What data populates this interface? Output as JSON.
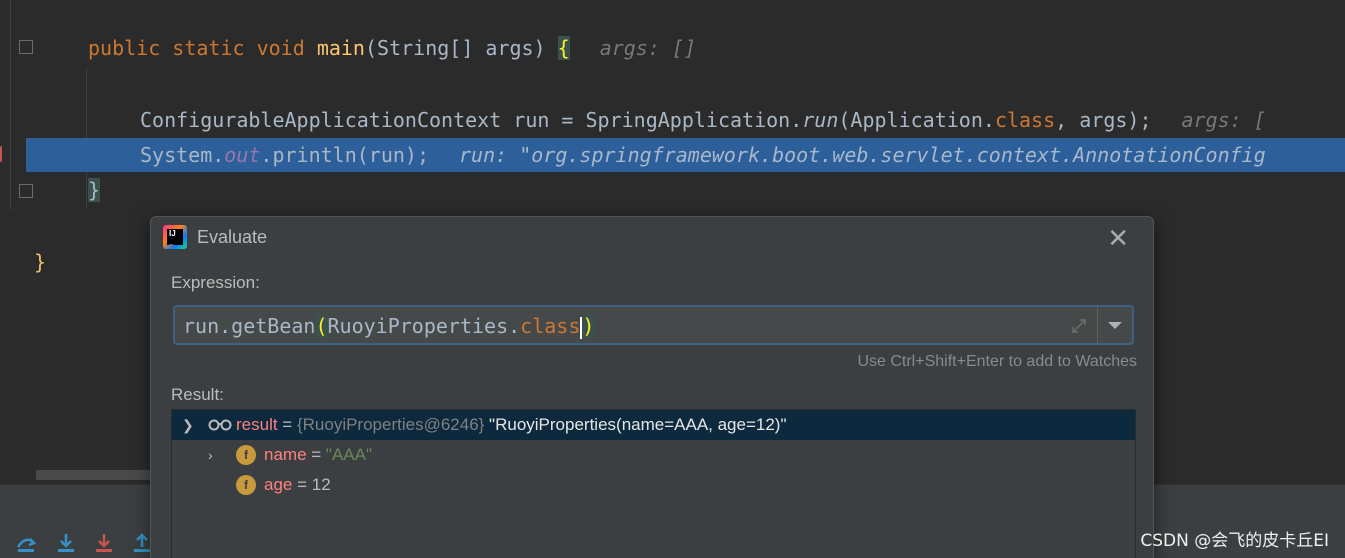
{
  "editor": {
    "line1": {
      "kw1": "public",
      "kw2": "static",
      "kw3": "void",
      "method": "main",
      "params": "(String[] args) ",
      "brace": "{",
      "hint": "args: []"
    },
    "line2": {
      "pre": "ConfigurableApplicationContext run = SpringApplication.",
      "call": "run",
      "mid": "(Application.",
      "kw": "class",
      "post": ", args);",
      "hint": "args: ["
    },
    "line3": {
      "pre": "System.",
      "field": "out",
      "post": ".println(run);",
      "hint": "run: \"org.springframework.boot.web.servlet.context.AnnotationConfig"
    },
    "line4": {
      "brace": "}"
    },
    "line5": {
      "brace": "}"
    }
  },
  "dialog": {
    "title": "Evaluate",
    "close_icon": "close-icon",
    "expression_label": "Expression:",
    "expression": {
      "pre": "run.getBean",
      "open": "(",
      "mid": "RuoyiProperties.",
      "kw": "class",
      "close": ")"
    },
    "watch_hint": "Use Ctrl+Shift+Enter to add to Watches",
    "result_label": "Result:",
    "result": {
      "root": {
        "name": "result",
        "eq": " = ",
        "type": "{RuoyiProperties@6246}",
        "value": " \"RuoyiProperties(name=AAA, age=12)\""
      },
      "children": [
        {
          "name": "name",
          "eq": " = ",
          "value": "\"AAA\""
        },
        {
          "name": "age",
          "eq": " = ",
          "value": "12"
        }
      ]
    }
  },
  "watermark": "CSDN @会飞的皮卡丘EI",
  "colors": {
    "keyword": "#cc7832",
    "method": "#ffc66d",
    "string": "#6a8759",
    "selection": "#2d5f9a"
  }
}
